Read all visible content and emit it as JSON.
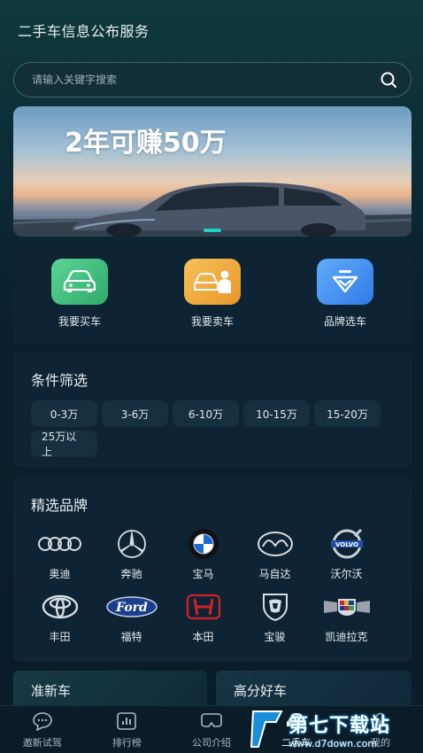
{
  "app": {
    "title": "二手车信息公布服务"
  },
  "search": {
    "placeholder": "请输入关键字搜索",
    "icon": "search-icon"
  },
  "banner": {
    "headline": "2年可赚50万"
  },
  "quick_actions": [
    {
      "label": "我要买车",
      "icon": "car-front-icon",
      "color": "#3cc37f"
    },
    {
      "label": "我要卖车",
      "icon": "car-seller-icon",
      "color": "#f2a93b"
    },
    {
      "label": "品牌选车",
      "icon": "brand-diamond-icon",
      "color": "#3f8ff2"
    }
  ],
  "filter": {
    "title": "条件筛选",
    "options": [
      "0-3万",
      "3-6万",
      "6-10万",
      "10-15万",
      "15-20万",
      "25万以上"
    ]
  },
  "brands": {
    "title": "精选品牌",
    "items": [
      {
        "name": "奥迪",
        "icon": "audi-logo-icon"
      },
      {
        "name": "奔驰",
        "icon": "mercedes-logo-icon"
      },
      {
        "name": "宝马",
        "icon": "bmw-logo-icon"
      },
      {
        "name": "马自达",
        "icon": "mazda-logo-icon"
      },
      {
        "name": "沃尔沃",
        "icon": "volvo-logo-icon"
      },
      {
        "name": "丰田",
        "icon": "toyota-logo-icon"
      },
      {
        "name": "福特",
        "icon": "ford-logo-icon"
      },
      {
        "name": "本田",
        "icon": "honda-logo-icon"
      },
      {
        "name": "宝骏",
        "icon": "baojun-logo-icon"
      },
      {
        "name": "凯迪拉克",
        "icon": "cadillac-logo-icon"
      }
    ]
  },
  "cards": {
    "new_car": "准新车",
    "high_score": "高分好车"
  },
  "tabbar": [
    {
      "label": "邀新试驾",
      "icon": "chat-bubble-icon"
    },
    {
      "label": "排行榜",
      "icon": "bar-chart-icon"
    },
    {
      "label": "公司介绍",
      "icon": "vr-headset-icon"
    },
    {
      "label": "二手车",
      "icon": "car-icon"
    },
    {
      "label": "我的",
      "icon": "user-icon"
    }
  ],
  "watermark": {
    "name": "第七下载站",
    "url": "www.d7down.com"
  }
}
